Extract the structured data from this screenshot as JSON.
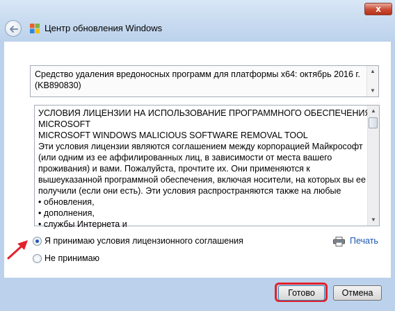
{
  "window": {
    "close_label": "x",
    "title": "Центр обновления Windows"
  },
  "update_name": "Средство удаления вредоносных программ для платформы x64: октябрь 2016 г. (KB890830)",
  "license_lines": [
    "УСЛОВИЯ ЛИЦЕНЗИИ НА ИСПОЛЬЗОВАНИЕ ПРОГРАММНОГО ОБЕСПЕЧЕНИЯ",
    "MICROSOFT",
    "MICROSOFT WINDOWS MALICIOUS SOFTWARE REMOVAL TOOL",
    "Эти условия лицензии являются соглашением между корпорацией Майкрософт",
    "(или одним из ее аффилированных лиц, в зависимости от места вашего",
    "проживания) и вами.  Пожалуйста, прочтите их.  Они применяются к",
    "вышеуказанной программной обеспечения, включая носители, на которых вы ее",
    "получили (если они есть).  Эти условия распространяются также на любые",
    "• обновления,",
    "• дополнения,",
    "• службы Интернета и"
  ],
  "options": {
    "accept": "Я принимаю условия лицензионного соглашения",
    "decline": "Не принимаю",
    "selected": "accept"
  },
  "print_label": "Печать",
  "buttons": {
    "ok": "Готово",
    "cancel": "Отмена"
  },
  "colors": {
    "accent": "#1f56b8",
    "highlight": "#e2222b"
  }
}
